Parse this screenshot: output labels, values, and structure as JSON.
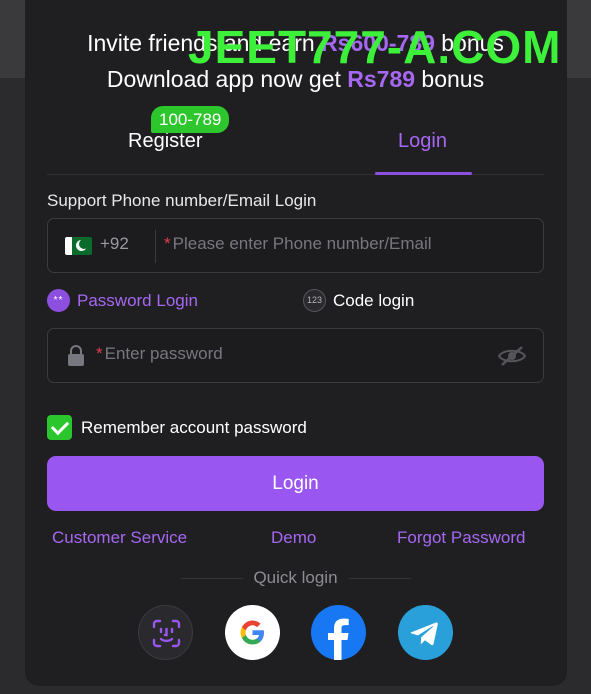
{
  "watermark": "JEET777-A.COM",
  "promo": {
    "line1_prefix": "Invite friends and earn ",
    "line1_amount": "Rs600-789",
    "line1_suffix": " bonus",
    "line2_prefix": "Download app now get ",
    "line2_amount": "Rs789",
    "line2_suffix": " bonus"
  },
  "tabs": {
    "register": "Register",
    "register_badge": "100-789",
    "login": "Login",
    "active": "Login"
  },
  "form": {
    "section_label": "Support Phone number/Email Login",
    "country_code": "+92",
    "required_mark": "*",
    "phone_placeholder": "Please enter Phone number/Email",
    "mode_password": "Password Login",
    "mode_password_icon_text": "**",
    "mode_code": "Code login",
    "mode_code_icon_text": "123",
    "password_placeholder": "Enter password",
    "remember_label": "Remember account password",
    "remember_checked": true,
    "login_button": "Login"
  },
  "links": {
    "customer_service": "Customer Service",
    "demo": "Demo",
    "forgot_password": "Forgot Password"
  },
  "quick_login": {
    "label": "Quick login",
    "providers": [
      "face-id-icon",
      "google-icon",
      "facebook-icon",
      "telegram-icon"
    ]
  },
  "colors": {
    "accent": "#9a56f0",
    "badge_green": "#2dc62d",
    "watermark_green": "#3df03a",
    "panel": "#1f1f22"
  }
}
